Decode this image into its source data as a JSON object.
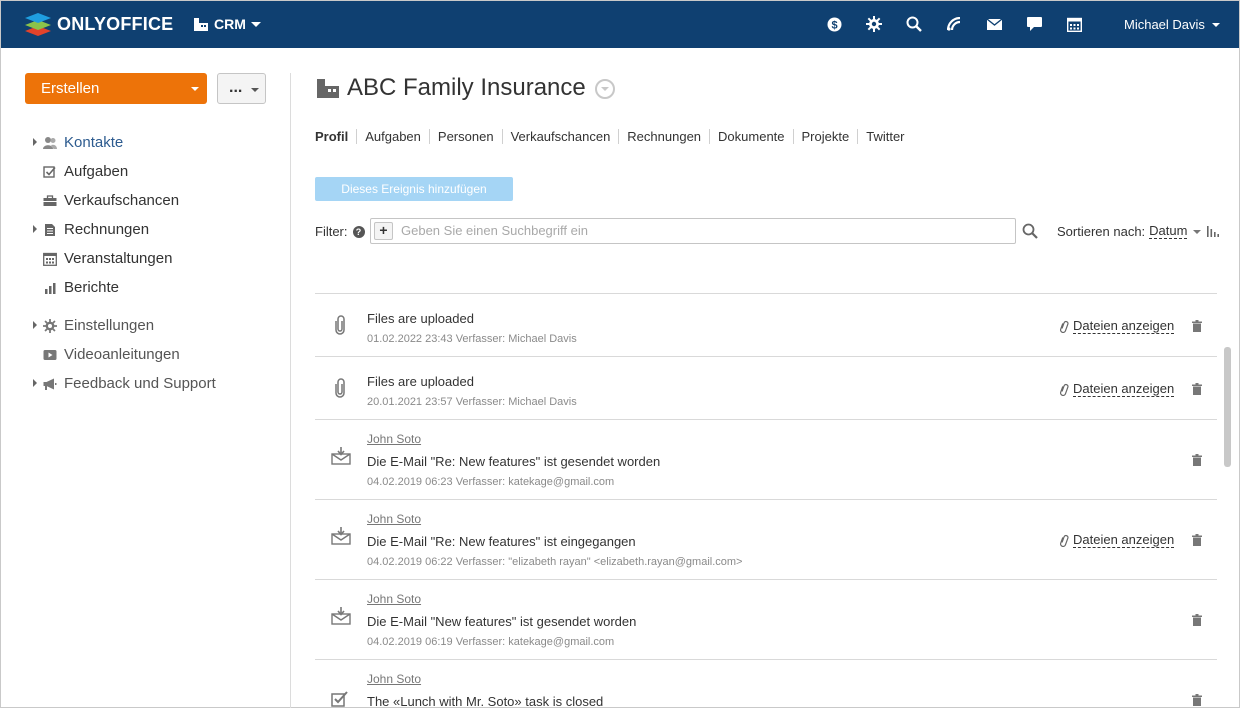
{
  "brand": {
    "name": "ONLYOFFICE"
  },
  "header": {
    "module": "CRM",
    "user": "Michael Davis",
    "icons": [
      "payment-icon",
      "settings-icon",
      "search-icon",
      "feed-icon",
      "mail-icon",
      "chat-icon",
      "calendar-icon"
    ]
  },
  "sidebar": {
    "create_label": "Erstellen",
    "more_label": "...",
    "items": [
      {
        "label": "Kontakte",
        "icon": "contacts-icon"
      },
      {
        "label": "Aufgaben",
        "icon": "tasks-icon"
      },
      {
        "label": "Verkaufschancen",
        "icon": "opportunities-icon"
      },
      {
        "label": "Rechnungen",
        "icon": "invoices-icon"
      },
      {
        "label": "Veranstaltungen",
        "icon": "events-icon"
      },
      {
        "label": "Berichte",
        "icon": "reports-icon"
      },
      {
        "label": "Einstellungen",
        "icon": "settings-icon"
      },
      {
        "label": "Videoanleitungen",
        "icon": "video-icon"
      },
      {
        "label": "Feedback und Support",
        "icon": "megaphone-icon"
      }
    ]
  },
  "main": {
    "title": "ABC Family Insurance",
    "tabs": [
      {
        "label": "Profil"
      },
      {
        "label": "Aufgaben"
      },
      {
        "label": "Personen"
      },
      {
        "label": "Verkaufschancen"
      },
      {
        "label": "Rechnungen"
      },
      {
        "label": "Dokumente"
      },
      {
        "label": "Projekte"
      },
      {
        "label": "Twitter"
      }
    ],
    "add_event_label": "Dieses Ereignis hinzufügen",
    "filter_label": "Filter:",
    "search_placeholder": "Geben Sie einen Suchbegriff ein",
    "sort_label": "Sortieren nach:",
    "sort_value": "Datum",
    "files_label": "Dateien anzeigen",
    "events": [
      {
        "type": "attachment",
        "title": "Files are uploaded",
        "meta": "01.02.2022 23:43 Verfasser: Michael Davis",
        "has_files": true
      },
      {
        "type": "attachment",
        "title": "Files are uploaded",
        "meta": "20.01.2021 23:57 Verfasser: Michael Davis",
        "has_files": true
      },
      {
        "type": "mail-sent",
        "author": "John Soto",
        "title": "Die E-Mail \"Re: New features\" ist gesendet worden",
        "meta": "04.02.2019 06:23 Verfasser: katekage@gmail.com",
        "has_files": false
      },
      {
        "type": "mail-received",
        "author": "John Soto",
        "title": "Die E-Mail \"Re: New features\" ist eingegangen",
        "meta": "04.02.2019 06:22 Verfasser: \"elizabeth rayan\" <elizabeth.rayan@gmail.com>",
        "has_files": true
      },
      {
        "type": "mail-sent",
        "author": "John Soto",
        "title": "Die E-Mail \"New features\" ist gesendet worden",
        "meta": "04.02.2019 06:19 Verfasser: katekage@gmail.com",
        "has_files": false
      },
      {
        "type": "task",
        "author": "John Soto",
        "title": "The «Lunch with Mr. Soto» task is closed",
        "meta": "",
        "has_files": false
      }
    ]
  },
  "colors": {
    "header_bg": "#0f4071",
    "create_button": "#ed7309",
    "add_event_button": "#a5d5f5",
    "active_link": "#2d5b8f"
  }
}
